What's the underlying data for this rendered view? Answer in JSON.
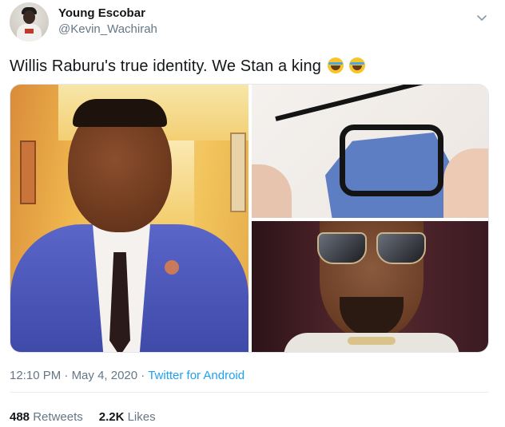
{
  "author": {
    "display_name": "Young Escobar",
    "handle": "@Kevin_Wachirah",
    "avatar_icon": "profile-avatar"
  },
  "menu_icon": "chevron-down-icon",
  "tweet": {
    "text": "Willis Raburu's true identity. We Stan a king",
    "emojis": [
      "face-with-tears-of-joy",
      "face-with-tears-of-joy"
    ]
  },
  "meta": {
    "time": "12:10 PM",
    "sep1": "·",
    "date": "May 4, 2020",
    "sep2": "·",
    "source": "Twitter for Android"
  },
  "stats": {
    "retweets_count": "488",
    "retweets_label": "Retweets",
    "likes_count": "2.2K",
    "likes_label": "Likes"
  },
  "colors": {
    "link": "#1da1f2",
    "secondary_text": "#657786",
    "primary_text": "#14171a"
  }
}
